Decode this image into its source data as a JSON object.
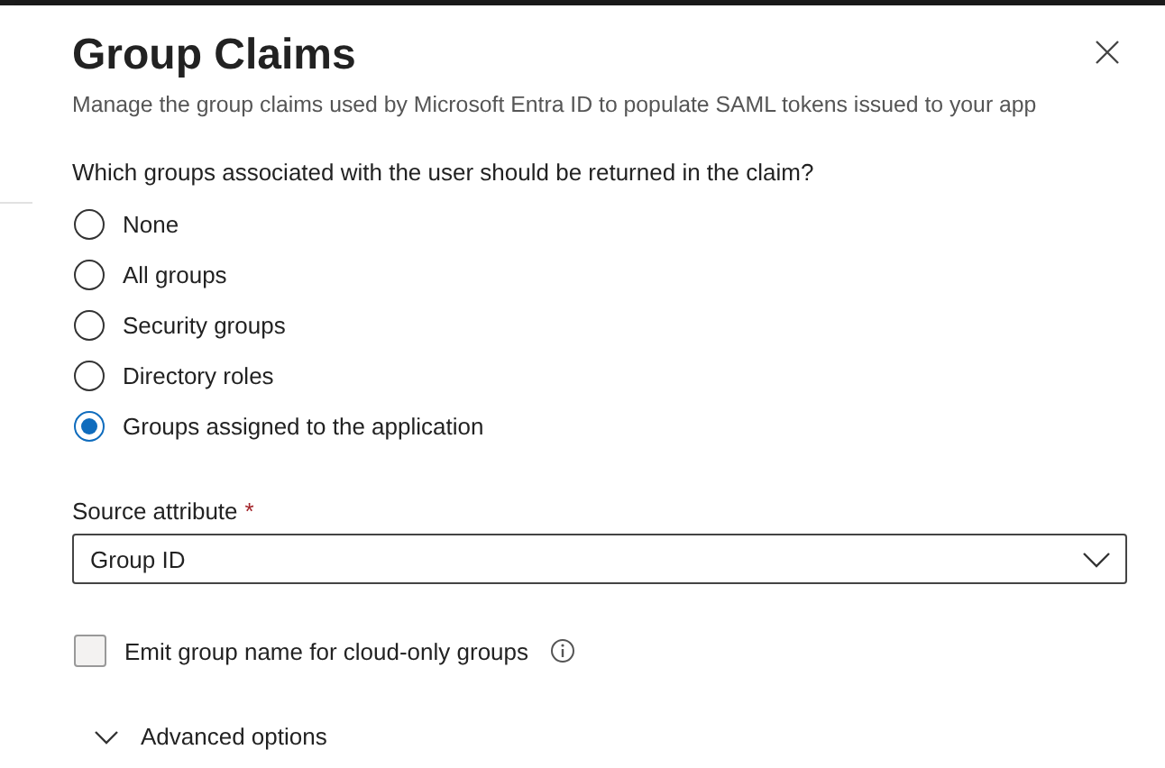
{
  "panel": {
    "title": "Group Claims",
    "subtitle": "Manage the group claims used by Microsoft Entra ID to populate SAML tokens issued to your app"
  },
  "question": "Which groups associated with the user should be returned in the claim?",
  "options": [
    {
      "label": "None",
      "selected": false
    },
    {
      "label": "All groups",
      "selected": false
    },
    {
      "label": "Security groups",
      "selected": false
    },
    {
      "label": "Directory roles",
      "selected": false
    },
    {
      "label": "Groups assigned to the application",
      "selected": true
    }
  ],
  "source_attribute": {
    "label": "Source attribute",
    "required_mark": "*",
    "value": "Group ID"
  },
  "emit_checkbox": {
    "label": "Emit group name for cloud-only groups",
    "checked": false
  },
  "advanced": {
    "label": "Advanced options",
    "expanded": false
  }
}
